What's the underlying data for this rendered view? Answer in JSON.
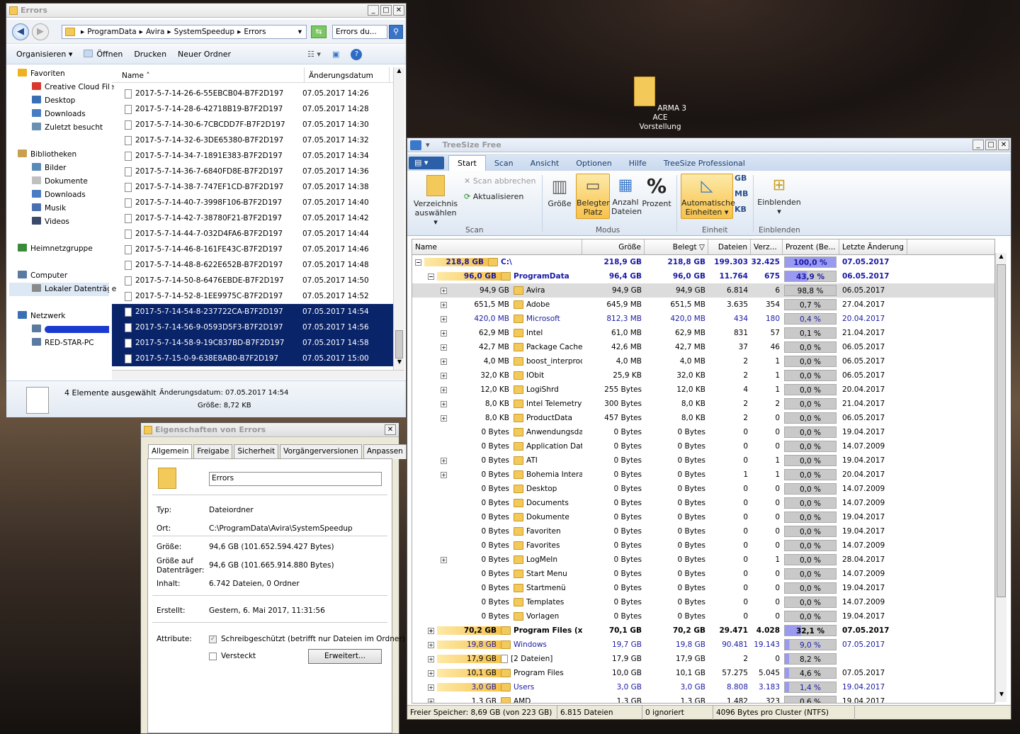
{
  "desktop": {
    "icon_label": "ARMA 3 ACE Vorstellung"
  },
  "explorer": {
    "title": "Errors",
    "path": [
      "ProgramData",
      "Avira",
      "SystemSpeedup",
      "Errors"
    ],
    "search_placeholder": "Errors du...",
    "commands": [
      "Organisieren",
      "Öffnen",
      "Drucken",
      "Neuer Ordner"
    ],
    "nav": [
      {
        "label": "Favoriten",
        "icon": "star-icon",
        "group": true
      },
      {
        "label": "Creative Cloud File",
        "icon": "cloud-icon"
      },
      {
        "label": "Desktop",
        "icon": "desktop-icon"
      },
      {
        "label": "Downloads",
        "icon": "downloads-icon"
      },
      {
        "label": "Zuletzt besucht",
        "icon": "recent-icon"
      },
      {
        "label": "",
        "icon": ""
      },
      {
        "label": "Bibliotheken",
        "icon": "library-icon",
        "group": true
      },
      {
        "label": "Bilder",
        "icon": "pictures-icon"
      },
      {
        "label": "Dokumente",
        "icon": "documents-icon"
      },
      {
        "label": "Downloads",
        "icon": "downloads-icon"
      },
      {
        "label": "Musik",
        "icon": "music-icon"
      },
      {
        "label": "Videos",
        "icon": "videos-icon"
      },
      {
        "label": "",
        "icon": ""
      },
      {
        "label": "Heimnetzgruppe",
        "icon": "homegroup-icon",
        "group": true
      },
      {
        "label": "",
        "icon": ""
      },
      {
        "label": "Computer",
        "icon": "computer-icon",
        "group": true
      },
      {
        "label": "Lokaler Datenträge",
        "icon": "drive-icon",
        "selected": true
      },
      {
        "label": "",
        "icon": ""
      },
      {
        "label": "Netzwerk",
        "icon": "network-icon",
        "group": true
      },
      {
        "label": "",
        "icon": "pc-icon"
      },
      {
        "label": "RED-STAR-PC",
        "icon": "pc-icon"
      }
    ],
    "columns": {
      "name": "Name",
      "date": "Änderungsdatum"
    },
    "files": [
      {
        "name": "2017-5-7-14-26-6-55EBCB04-B7F2D197",
        "date": "07.05.2017 14:26"
      },
      {
        "name": "2017-5-7-14-28-6-42718B19-B7F2D197",
        "date": "07.05.2017 14:28"
      },
      {
        "name": "2017-5-7-14-30-6-7CBCDD7F-B7F2D197",
        "date": "07.05.2017 14:30"
      },
      {
        "name": "2017-5-7-14-32-6-3DE65380-B7F2D197",
        "date": "07.05.2017 14:32"
      },
      {
        "name": "2017-5-7-14-34-7-1891E383-B7F2D197",
        "date": "07.05.2017 14:34"
      },
      {
        "name": "2017-5-7-14-36-7-6840FD8E-B7F2D197",
        "date": "07.05.2017 14:36"
      },
      {
        "name": "2017-5-7-14-38-7-747EF1CD-B7F2D197",
        "date": "07.05.2017 14:38"
      },
      {
        "name": "2017-5-7-14-40-7-3998F106-B7F2D197",
        "date": "07.05.2017 14:40"
      },
      {
        "name": "2017-5-7-14-42-7-38780F21-B7F2D197",
        "date": "07.05.2017 14:42"
      },
      {
        "name": "2017-5-7-14-44-7-032D4FA6-B7F2D197",
        "date": "07.05.2017 14:44"
      },
      {
        "name": "2017-5-7-14-46-8-161FE43C-B7F2D197",
        "date": "07.05.2017 14:46"
      },
      {
        "name": "2017-5-7-14-48-8-622E652B-B7F2D197",
        "date": "07.05.2017 14:48"
      },
      {
        "name": "2017-5-7-14-50-8-6476EBDE-B7F2D197",
        "date": "07.05.2017 14:50"
      },
      {
        "name": "2017-5-7-14-52-8-1EE9975C-B7F2D197",
        "date": "07.05.2017 14:52"
      },
      {
        "name": "2017-5-7-14-54-8-237722CA-B7F2D197",
        "date": "07.05.2017 14:54",
        "selected": true
      },
      {
        "name": "2017-5-7-14-56-9-0593D5F3-B7F2D197",
        "date": "07.05.2017 14:56",
        "selected": true
      },
      {
        "name": "2017-5-7-14-58-9-19C837BD-B7F2D197",
        "date": "07.05.2017 14:58",
        "selected": true
      },
      {
        "name": "2017-5-7-15-0-9-638E8AB0-B7F2D197",
        "date": "07.05.2017 15:00",
        "selected": true
      }
    ],
    "details": {
      "selected": "4 Elemente ausgewählt",
      "date_label": "Änderungsdatum: 07.05.2017 14:54",
      "size": "Größe: 8,72 KB"
    }
  },
  "props": {
    "title": "Eigenschaften von Errors",
    "tabs": [
      "Allgemein",
      "Freigabe",
      "Sicherheit",
      "Vorgängerversionen",
      "Anpassen"
    ],
    "name": "Errors",
    "rows": [
      {
        "label": "Typ:",
        "value": "Dateiordner"
      },
      {
        "label": "Ort:",
        "value": "C:\\ProgramData\\Avira\\SystemSpeedup"
      },
      {
        "label": "Größe:",
        "value": "94,6 GB (101.652.594.427 Bytes)"
      },
      {
        "label": "Größe auf Datenträger:",
        "value": "94,6 GB (101.665.914.880 Bytes)"
      },
      {
        "label": "Inhalt:",
        "value": "6.742 Dateien, 0 Ordner"
      },
      {
        "label": "Erstellt:",
        "value": "Gestern, 6. Mai 2017, 11:31:56"
      },
      {
        "label": "Attribute:",
        "value": ""
      }
    ],
    "readonly": "Schreibgeschützt (betrifft nur Dateien im Ordner)",
    "hidden": "Versteckt",
    "advanced": "Erweitert..."
  },
  "treesize": {
    "title": "TreeSize Free",
    "tabs": [
      "Start",
      "Scan",
      "Ansicht",
      "Optionen",
      "Hilfe",
      "TreeSize Professional"
    ],
    "ribbon": {
      "select_dir": "Verzeichnis auswählen",
      "scan_cancel": "Scan abbrechen",
      "refresh": "Aktualisieren",
      "grp_scan": "Scan",
      "size": "Größe",
      "allocated": "Belegter Platz",
      "file_count": "Anzahl Dateien",
      "percent": "Prozent",
      "grp_mode": "Modus",
      "auto_units": "Automatische Einheiten",
      "gb": "GB",
      "mb": "MB",
      "kb": "KB",
      "grp_unit": "Einheit",
      "show": "Einblenden",
      "grp_show": "Einblenden"
    },
    "columns": [
      "Name",
      "Größe",
      "Belegt",
      "Dateien",
      "Verz...",
      "Prozent (Be...",
      "Letzte Änderung"
    ],
    "rows": [
      {
        "lvl": 0,
        "exp": "−",
        "badge": "218,8 GB",
        "name": "C:\\",
        "g": "218,9 GB",
        "b": "218,8 GB",
        "d": "199.303",
        "v": "32.425",
        "p": "100,0 %",
        "l": "07.05.2017",
        "bold": true,
        "blue": true,
        "fill": 1.0
      },
      {
        "lvl": 1,
        "exp": "−",
        "badge": "96,0 GB",
        "name": "ProgramData",
        "g": "96,4 GB",
        "b": "96,0 GB",
        "d": "11.764",
        "v": "675",
        "p": "43,9 %",
        "l": "06.05.2017",
        "bold": true,
        "blue": true,
        "fill": 0.439
      },
      {
        "lvl": 2,
        "exp": "+",
        "badge": "94,9 GB",
        "name": "Avira",
        "g": "94,9 GB",
        "b": "94,9 GB",
        "d": "6.814",
        "v": "6",
        "p": "98,8 %",
        "l": "06.05.2017",
        "hl": true
      },
      {
        "lvl": 2,
        "exp": "+",
        "badge": "651,5 MB",
        "name": "Adobe",
        "g": "645,9 MB",
        "b": "651,5 MB",
        "d": "3.635",
        "v": "354",
        "p": "0,7 %",
        "l": "27.04.2017"
      },
      {
        "lvl": 2,
        "exp": "+",
        "badge": "420,0 MB",
        "name": "Microsoft",
        "g": "812,3 MB",
        "b": "420,0 MB",
        "d": "434",
        "v": "180",
        "p": "0,4 %",
        "l": "20.04.2017",
        "blue": true
      },
      {
        "lvl": 2,
        "exp": "+",
        "badge": "62,9 MB",
        "name": "Intel",
        "g": "61,0 MB",
        "b": "62,9 MB",
        "d": "831",
        "v": "57",
        "p": "0,1 %",
        "l": "21.04.2017"
      },
      {
        "lvl": 2,
        "exp": "+",
        "badge": "42,7 MB",
        "name": "Package Cache",
        "g": "42,6 MB",
        "b": "42,7 MB",
        "d": "37",
        "v": "46",
        "p": "0,0 %",
        "l": "06.05.2017"
      },
      {
        "lvl": 2,
        "exp": "+",
        "badge": "4,0 MB",
        "name": "boost_interprocess",
        "g": "4,0 MB",
        "b": "4,0 MB",
        "d": "2",
        "v": "1",
        "p": "0,0 %",
        "l": "06.05.2017"
      },
      {
        "lvl": 2,
        "exp": "+",
        "badge": "32,0 KB",
        "name": "IObit",
        "g": "25,9 KB",
        "b": "32,0 KB",
        "d": "2",
        "v": "1",
        "p": "0,0 %",
        "l": "06.05.2017"
      },
      {
        "lvl": 2,
        "exp": "+",
        "badge": "12,0 KB",
        "name": "LogiShrd",
        "g": "255 Bytes",
        "b": "12,0 KB",
        "d": "4",
        "v": "1",
        "p": "0,0 %",
        "l": "20.04.2017"
      },
      {
        "lvl": 2,
        "exp": "+",
        "badge": "8,0 KB",
        "name": "Intel Telemetry",
        "g": "300 Bytes",
        "b": "8,0 KB",
        "d": "2",
        "v": "2",
        "p": "0,0 %",
        "l": "21.04.2017"
      },
      {
        "lvl": 2,
        "exp": "+",
        "badge": "8,0 KB",
        "name": "ProductData",
        "g": "457 Bytes",
        "b": "8,0 KB",
        "d": "2",
        "v": "0",
        "p": "0,0 %",
        "l": "06.05.2017"
      },
      {
        "lvl": 2,
        "exp": "",
        "badge": "0 Bytes",
        "name": "Anwendungsdaten",
        "g": "0 Bytes",
        "b": "0 Bytes",
        "d": "0",
        "v": "0",
        "p": "0,0 %",
        "l": "19.04.2017"
      },
      {
        "lvl": 2,
        "exp": "",
        "badge": "0 Bytes",
        "name": "Application Data",
        "g": "0 Bytes",
        "b": "0 Bytes",
        "d": "0",
        "v": "0",
        "p": "0,0 %",
        "l": "14.07.2009"
      },
      {
        "lvl": 2,
        "exp": "+",
        "badge": "0 Bytes",
        "name": "ATI",
        "g": "0 Bytes",
        "b": "0 Bytes",
        "d": "0",
        "v": "1",
        "p": "0,0 %",
        "l": "19.04.2017"
      },
      {
        "lvl": 2,
        "exp": "+",
        "badge": "0 Bytes",
        "name": "Bohemia Interactive",
        "g": "0 Bytes",
        "b": "0 Bytes",
        "d": "1",
        "v": "1",
        "p": "0,0 %",
        "l": "20.04.2017"
      },
      {
        "lvl": 2,
        "exp": "",
        "badge": "0 Bytes",
        "name": "Desktop",
        "g": "0 Bytes",
        "b": "0 Bytes",
        "d": "0",
        "v": "0",
        "p": "0,0 %",
        "l": "14.07.2009"
      },
      {
        "lvl": 2,
        "exp": "",
        "badge": "0 Bytes",
        "name": "Documents",
        "g": "0 Bytes",
        "b": "0 Bytes",
        "d": "0",
        "v": "0",
        "p": "0,0 %",
        "l": "14.07.2009"
      },
      {
        "lvl": 2,
        "exp": "",
        "badge": "0 Bytes",
        "name": "Dokumente",
        "g": "0 Bytes",
        "b": "0 Bytes",
        "d": "0",
        "v": "0",
        "p": "0,0 %",
        "l": "19.04.2017"
      },
      {
        "lvl": 2,
        "exp": "",
        "badge": "0 Bytes",
        "name": "Favoriten",
        "g": "0 Bytes",
        "b": "0 Bytes",
        "d": "0",
        "v": "0",
        "p": "0,0 %",
        "l": "19.04.2017"
      },
      {
        "lvl": 2,
        "exp": "",
        "badge": "0 Bytes",
        "name": "Favorites",
        "g": "0 Bytes",
        "b": "0 Bytes",
        "d": "0",
        "v": "0",
        "p": "0,0 %",
        "l": "14.07.2009"
      },
      {
        "lvl": 2,
        "exp": "+",
        "badge": "0 Bytes",
        "name": "LogMeIn",
        "g": "0 Bytes",
        "b": "0 Bytes",
        "d": "0",
        "v": "1",
        "p": "0,0 %",
        "l": "28.04.2017"
      },
      {
        "lvl": 2,
        "exp": "",
        "badge": "0 Bytes",
        "name": "Start Menu",
        "g": "0 Bytes",
        "b": "0 Bytes",
        "d": "0",
        "v": "0",
        "p": "0,0 %",
        "l": "14.07.2009"
      },
      {
        "lvl": 2,
        "exp": "",
        "badge": "0 Bytes",
        "name": "Startmenü",
        "g": "0 Bytes",
        "b": "0 Bytes",
        "d": "0",
        "v": "0",
        "p": "0,0 %",
        "l": "19.04.2017"
      },
      {
        "lvl": 2,
        "exp": "",
        "badge": "0 Bytes",
        "name": "Templates",
        "g": "0 Bytes",
        "b": "0 Bytes",
        "d": "0",
        "v": "0",
        "p": "0,0 %",
        "l": "14.07.2009"
      },
      {
        "lvl": 2,
        "exp": "",
        "badge": "0 Bytes",
        "name": "Vorlagen",
        "g": "0 Bytes",
        "b": "0 Bytes",
        "d": "0",
        "v": "0",
        "p": "0,0 %",
        "l": "19.04.2017"
      },
      {
        "lvl": 1,
        "exp": "+",
        "badge": "70,2 GB",
        "name": "Program Files (x86)",
        "g": "70,1 GB",
        "b": "70,2 GB",
        "d": "29.471",
        "v": "4.028",
        "p": "32,1 %",
        "l": "07.05.2017",
        "bold": true,
        "fill": 0.321
      },
      {
        "lvl": 1,
        "exp": "+",
        "badge": "19,8 GB",
        "name": "Windows",
        "g": "19,7 GB",
        "b": "19,8 GB",
        "d": "90.481",
        "v": "19.143",
        "p": "9,0 %",
        "l": "07.05.2017",
        "blue": true,
        "fill": 0.09
      },
      {
        "lvl": 1,
        "exp": "+",
        "badge": "17,9 GB",
        "name": "[2 Dateien]",
        "g": "17,9 GB",
        "b": "17,9 GB",
        "d": "2",
        "v": "0",
        "p": "8,2 %",
        "l": "",
        "file": true,
        "fill": 0.082
      },
      {
        "lvl": 1,
        "exp": "+",
        "badge": "10,1 GB",
        "name": "Program Files",
        "g": "10,0 GB",
        "b": "10,1 GB",
        "d": "57.275",
        "v": "5.045",
        "p": "4,6 %",
        "l": "07.05.2017",
        "fill": 0.046
      },
      {
        "lvl": 1,
        "exp": "+",
        "badge": "3,0 GB",
        "name": "Users",
        "g": "3,0 GB",
        "b": "3,0 GB",
        "d": "8.808",
        "v": "3.183",
        "p": "1,4 %",
        "l": "19.04.2017",
        "blue": true,
        "fill": 0.014
      },
      {
        "lvl": 1,
        "exp": "+",
        "badge": "1,3 GB",
        "name": "AMD",
        "g": "1,3 GB",
        "b": "1,3 GB",
        "d": "1.482",
        "v": "323",
        "p": "0,6 %",
        "l": "19.04.2017"
      }
    ],
    "status": [
      "Freier Speicher: 8,69 GB  (von 223 GB)",
      "6.815  Dateien",
      "0 ignoriert",
      "4096  Bytes pro Cluster (NTFS)"
    ]
  }
}
